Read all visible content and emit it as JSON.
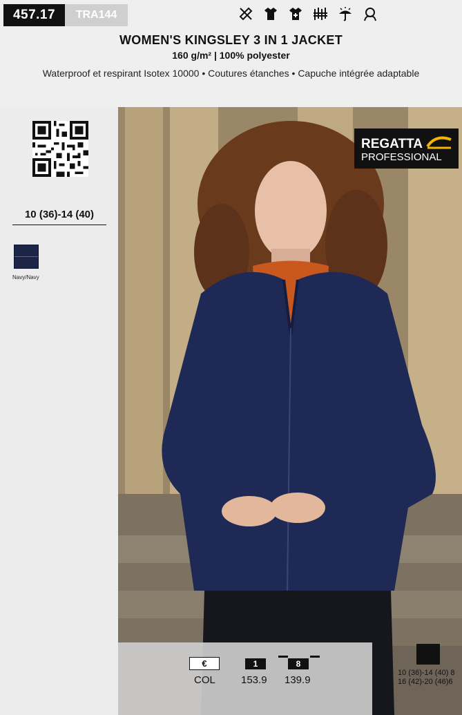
{
  "header": {
    "ref_code": "457.17",
    "sku": "TRA144",
    "title": "WOMEN'S KINGSLEY 3 IN 1 JACKET",
    "subtitle": "160 g/m² | 100% polyester",
    "description": "Waterproof et respirant Isotex 10000 • Coutures étanches • Capuche intégrée adaptable",
    "feature_icons": [
      "no-iron-icon",
      "tshirt-icon",
      "tshirt-plus-icon",
      "fabric-icon",
      "umbrella-sun-icon",
      "hood-icon"
    ]
  },
  "sidebar": {
    "sizes": "10 (36)-14 (40)",
    "colors": [
      {
        "name": "Navy/Navy",
        "hex": "#1d2547"
      }
    ]
  },
  "brand": {
    "line1": "REGATTA",
    "line2": "PROFESSIONAL",
    "accent": "#f2b600"
  },
  "pricing": {
    "currency_badge": "€",
    "col_label": "COL",
    "tiers": [
      {
        "qty": "1",
        "price": "153.9"
      },
      {
        "qty": "8",
        "price": "139.9"
      }
    ]
  },
  "packaging": {
    "line1": "10 (36)-14 (40)  8",
    "line2": "16 (42)-20 (46)6"
  }
}
